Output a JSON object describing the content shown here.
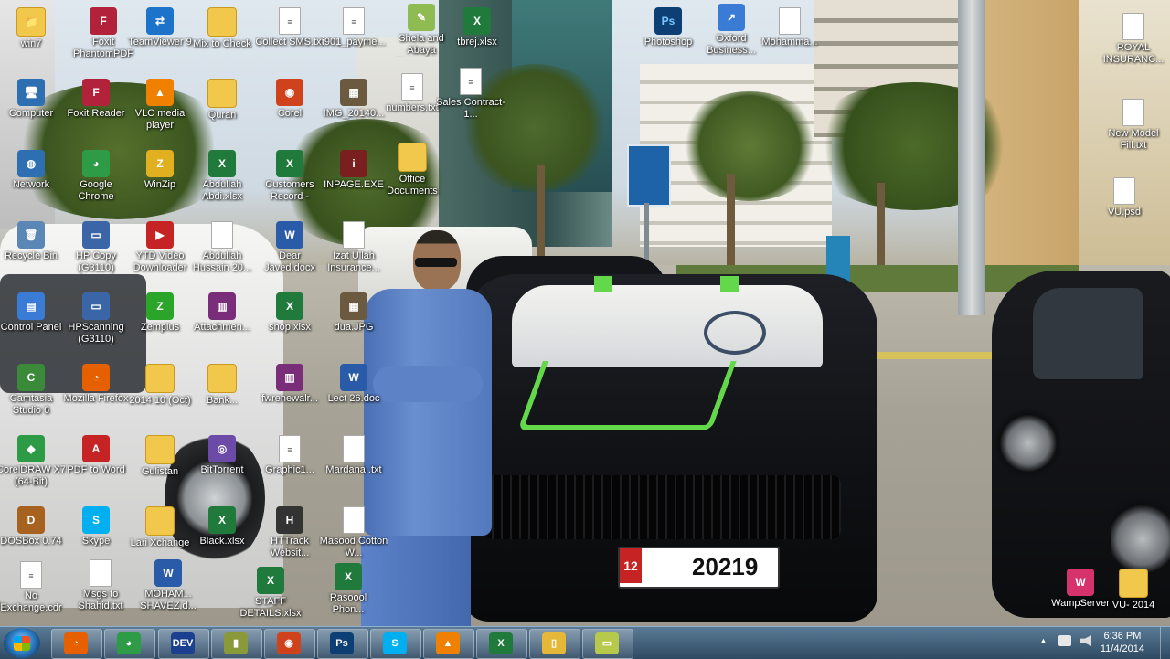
{
  "desktop": {
    "icons": [
      {
        "label": "win7",
        "glyph": "📁",
        "kind": "fld"
      },
      {
        "label": "Foxit PhantomPDF",
        "glyph": "F",
        "kind": "foxit"
      },
      {
        "label": "TeamViewer 9",
        "glyph": "⇄",
        "kind": "tv"
      },
      {
        "label": "Mix to Check",
        "glyph": "",
        "kind": "fld"
      },
      {
        "label": "Collect SMS.txt",
        "glyph": "≡",
        "kind": "doc"
      },
      {
        "label": "i901_payme...",
        "glyph": "≡",
        "kind": "doc"
      },
      {
        "label": "Shela and Abaya Notepad++",
        "glyph": "✎",
        "kind": "np"
      },
      {
        "label": "tbrej.xlsx",
        "glyph": "X",
        "kind": "xl"
      },
      {
        "label": "Photoshop",
        "glyph": "Ps",
        "kind": "ps"
      },
      {
        "label": "Oxford Business...",
        "glyph": "↗",
        "kind": "lnk"
      },
      {
        "label": "Mohamma...",
        "glyph": "",
        "kind": "doc"
      },
      {
        "label": "ROYAL INSURANC...",
        "glyph": "",
        "kind": "doc"
      },
      {
        "label": "Computer",
        "glyph": "🖥",
        "kind": "pc"
      },
      {
        "label": "Foxit Reader",
        "glyph": "F",
        "kind": "foxit"
      },
      {
        "label": "VLC media player",
        "glyph": "▲",
        "kind": "vlc"
      },
      {
        "label": "Quran",
        "glyph": "",
        "kind": "fld"
      },
      {
        "label": "Corel",
        "glyph": "◉",
        "kind": "corel"
      },
      {
        "label": "IMG_20140...",
        "glyph": "▦",
        "kind": "img"
      },
      {
        "label": "numbers.txt",
        "glyph": "≡",
        "kind": "doc"
      },
      {
        "label": "Sales Contract-1...",
        "glyph": "≡",
        "kind": "doc"
      },
      {
        "label": "New Model Fill.txt",
        "glyph": "",
        "kind": "doc"
      },
      {
        "label": "Network",
        "glyph": "◍",
        "kind": "net"
      },
      {
        "label": "Google Chrome",
        "glyph": "◕",
        "kind": "chrome"
      },
      {
        "label": "WinZip",
        "glyph": "Z",
        "kind": "zip"
      },
      {
        "label": "Abdullah Abdi.xlsx",
        "glyph": "X",
        "kind": "xl"
      },
      {
        "label": "Customers Record -",
        "glyph": "X",
        "kind": "xl"
      },
      {
        "label": "INPAGE.EXE",
        "glyph": "i",
        "kind": "inpage"
      },
      {
        "label": "Office Documents",
        "glyph": "",
        "kind": "fld"
      },
      {
        "label": "VU.psd",
        "glyph": "",
        "kind": "doc"
      },
      {
        "label": "Recycle Bin",
        "glyph": "🗑",
        "kind": "bin"
      },
      {
        "label": "HP Copy (G3110)",
        "glyph": "▭",
        "kind": "hp"
      },
      {
        "label": "YTD Video Downloader",
        "glyph": "▶",
        "kind": "ytd"
      },
      {
        "label": "Abdullah Hussain 20...",
        "glyph": "",
        "kind": "doc"
      },
      {
        "label": "Dear Javed.docx",
        "glyph": "W",
        "kind": "wd"
      },
      {
        "label": "Izat Ullah Insurance...",
        "glyph": "",
        "kind": "doc"
      },
      {
        "label": "Control Panel",
        "glyph": "▤",
        "kind": "cp"
      },
      {
        "label": "HPScanning (G3110)",
        "glyph": "▭",
        "kind": "hp"
      },
      {
        "label": "Zemplus",
        "glyph": "Z",
        "kind": "zem"
      },
      {
        "label": "Attachmen...",
        "glyph": "▥",
        "kind": "rar"
      },
      {
        "label": "shop.xlsx",
        "glyph": "X",
        "kind": "xl"
      },
      {
        "label": "dua.JPG",
        "glyph": "▦",
        "kind": "img"
      },
      {
        "label": "Camtasia Studio 6",
        "glyph": "C",
        "kind": "cam"
      },
      {
        "label": "Mozilla Firefox",
        "glyph": "◔",
        "kind": "ff"
      },
      {
        "label": "2014 10 (Oct)",
        "glyph": "",
        "kind": "fld"
      },
      {
        "label": "Bank...",
        "glyph": "",
        "kind": "fld"
      },
      {
        "label": "fwrenewalr...",
        "glyph": "▥",
        "kind": "rar"
      },
      {
        "label": "Lect 26.doc",
        "glyph": "W",
        "kind": "wd"
      },
      {
        "label": "CorelDRAW X7 (64-Bit)",
        "glyph": "◆",
        "kind": "cdr"
      },
      {
        "label": "PDF to Word",
        "glyph": "A",
        "kind": "pdf"
      },
      {
        "label": "Gulistan",
        "glyph": "",
        "kind": "fld"
      },
      {
        "label": "BitTorrent",
        "glyph": "◎",
        "kind": "bt"
      },
      {
        "label": "Graphic1...",
        "glyph": "≡",
        "kind": "doc"
      },
      {
        "label": "Mardana .txt",
        "glyph": "",
        "kind": "doc"
      },
      {
        "label": "DOSBox 0.74",
        "glyph": "D",
        "kind": "dos"
      },
      {
        "label": "Skype",
        "glyph": "S",
        "kind": "skype"
      },
      {
        "label": "Lari Xchange",
        "glyph": "",
        "kind": "fld"
      },
      {
        "label": "Black.xlsx",
        "glyph": "X",
        "kind": "xl"
      },
      {
        "label": "HTTrack Websit...",
        "glyph": "H",
        "kind": "ht"
      },
      {
        "label": "Masood Cotton W...",
        "glyph": "",
        "kind": "doc"
      },
      {
        "label": "No Exchange.cdr",
        "glyph": "≡",
        "kind": "doc"
      },
      {
        "label": "Msgs to Shahid.txt",
        "glyph": "",
        "kind": "doc"
      },
      {
        "label": "MOHAM... SHAVEZ.d...",
        "glyph": "W",
        "kind": "wd"
      },
      {
        "label": "STAFF DETAILS.xlsx",
        "glyph": "X",
        "kind": "xl"
      },
      {
        "label": "Rasoool Phon...",
        "glyph": "X",
        "kind": "xl"
      },
      {
        "label": "WampServer",
        "glyph": "W",
        "kind": "wamp"
      },
      {
        "label": "VU- 2014",
        "glyph": "",
        "kind": "fld"
      }
    ]
  },
  "taskbar": {
    "buttons": [
      {
        "name": "taskbar-firefox",
        "glyph": "◔",
        "color": "#e66000"
      },
      {
        "name": "taskbar-chrome",
        "glyph": "◕",
        "color": "#2e9b47"
      },
      {
        "name": "taskbar-dev",
        "glyph": "DEV",
        "color": "#1d3f8f"
      },
      {
        "name": "taskbar-gnuplot",
        "glyph": "▮",
        "color": "#8a9a3a"
      },
      {
        "name": "taskbar-corel",
        "glyph": "◉",
        "color": "#d0421b"
      },
      {
        "name": "taskbar-photoshop",
        "glyph": "Ps",
        "color": "#0e3f74"
      },
      {
        "name": "taskbar-skype",
        "glyph": "S",
        "color": "#00aff0"
      },
      {
        "name": "taskbar-vlc",
        "glyph": "▲",
        "color": "#f08000"
      },
      {
        "name": "taskbar-excel",
        "glyph": "X",
        "color": "#1f7a3b"
      },
      {
        "name": "taskbar-explorer",
        "glyph": "▯",
        "color": "#e6b83a"
      },
      {
        "name": "taskbar-notes",
        "glyph": "▭",
        "color": "#b6c94a"
      }
    ],
    "clock": {
      "time": "6:36 PM",
      "date": "11/4/2014"
    }
  }
}
